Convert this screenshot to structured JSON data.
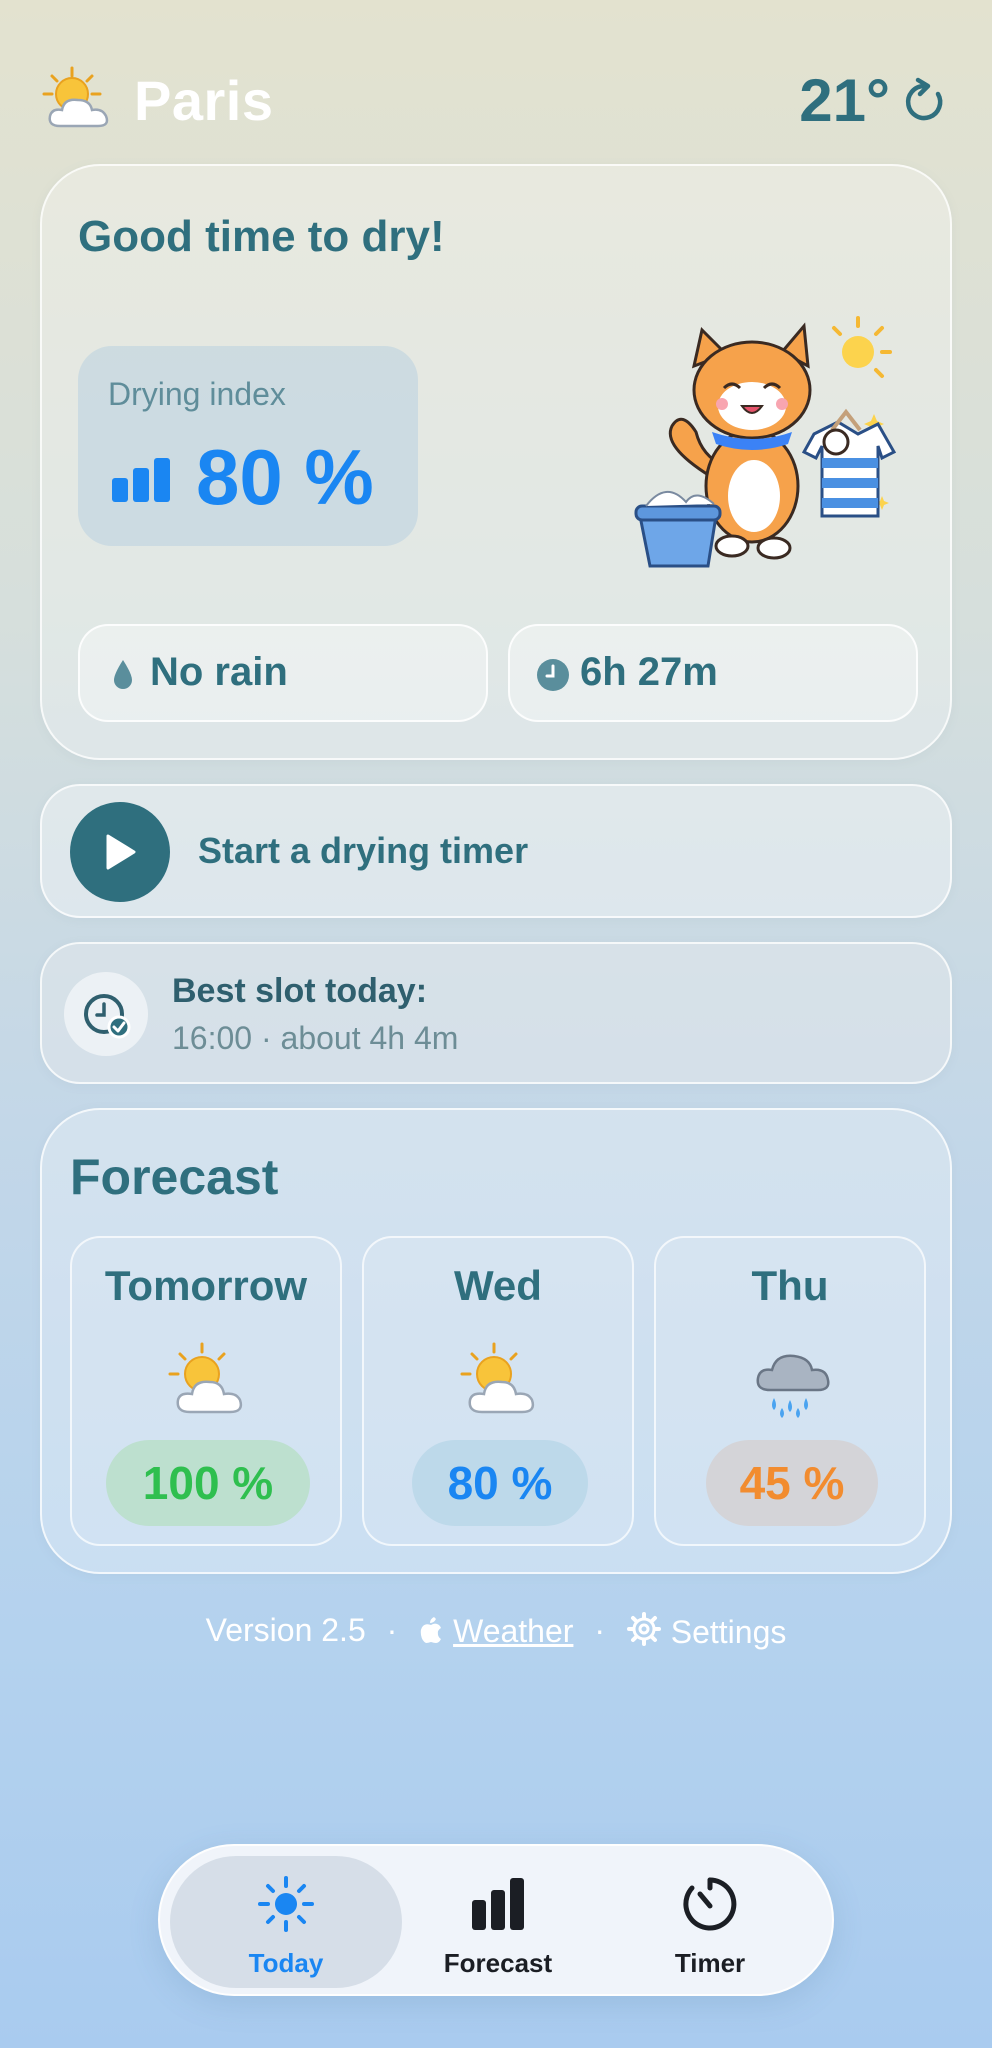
{
  "header": {
    "city": "Paris",
    "temperature": "21°",
    "weather_icon": "sun-behind-cloud-icon",
    "refresh_icon": "refresh-icon"
  },
  "main_card": {
    "title": "Good time to dry!",
    "drying_index_label": "Drying index",
    "drying_index_value": "80 %",
    "rain_status": "No rain",
    "duration": "6h 27m",
    "illustration": "cat-drying-laundry-illustration"
  },
  "timer": {
    "label": "Start a drying timer"
  },
  "best_slot": {
    "title": "Best slot today:",
    "detail": "16:00 · about 4h 4m"
  },
  "forecast": {
    "title": "Forecast",
    "days": [
      {
        "name": "Tomorrow",
        "icon": "sun-behind-cloud-icon",
        "value": "100 %",
        "color": "#2fbf4f",
        "badge_bg": "#bde0cf"
      },
      {
        "name": "Wed",
        "icon": "sun-behind-cloud-icon",
        "value": "80 %",
        "color": "#1a86f2",
        "badge_bg": "#bdd9ea"
      },
      {
        "name": "Thu",
        "icon": "rain-cloud-icon",
        "value": "45 %",
        "color": "#f28c2f",
        "badge_bg": "#d4d4d8"
      }
    ]
  },
  "footer": {
    "version": "Version 2.5",
    "weather_link": "Weather",
    "settings_link": "Settings"
  },
  "tabbar": {
    "tabs": [
      {
        "label": "Today",
        "icon": "sun-icon",
        "active": true
      },
      {
        "label": "Forecast",
        "icon": "bar-chart-icon",
        "active": false
      },
      {
        "label": "Timer",
        "icon": "timer-icon",
        "active": false
      }
    ]
  },
  "colors": {
    "accent_blue": "#1a86f2",
    "teal": "#2f6f7e"
  }
}
